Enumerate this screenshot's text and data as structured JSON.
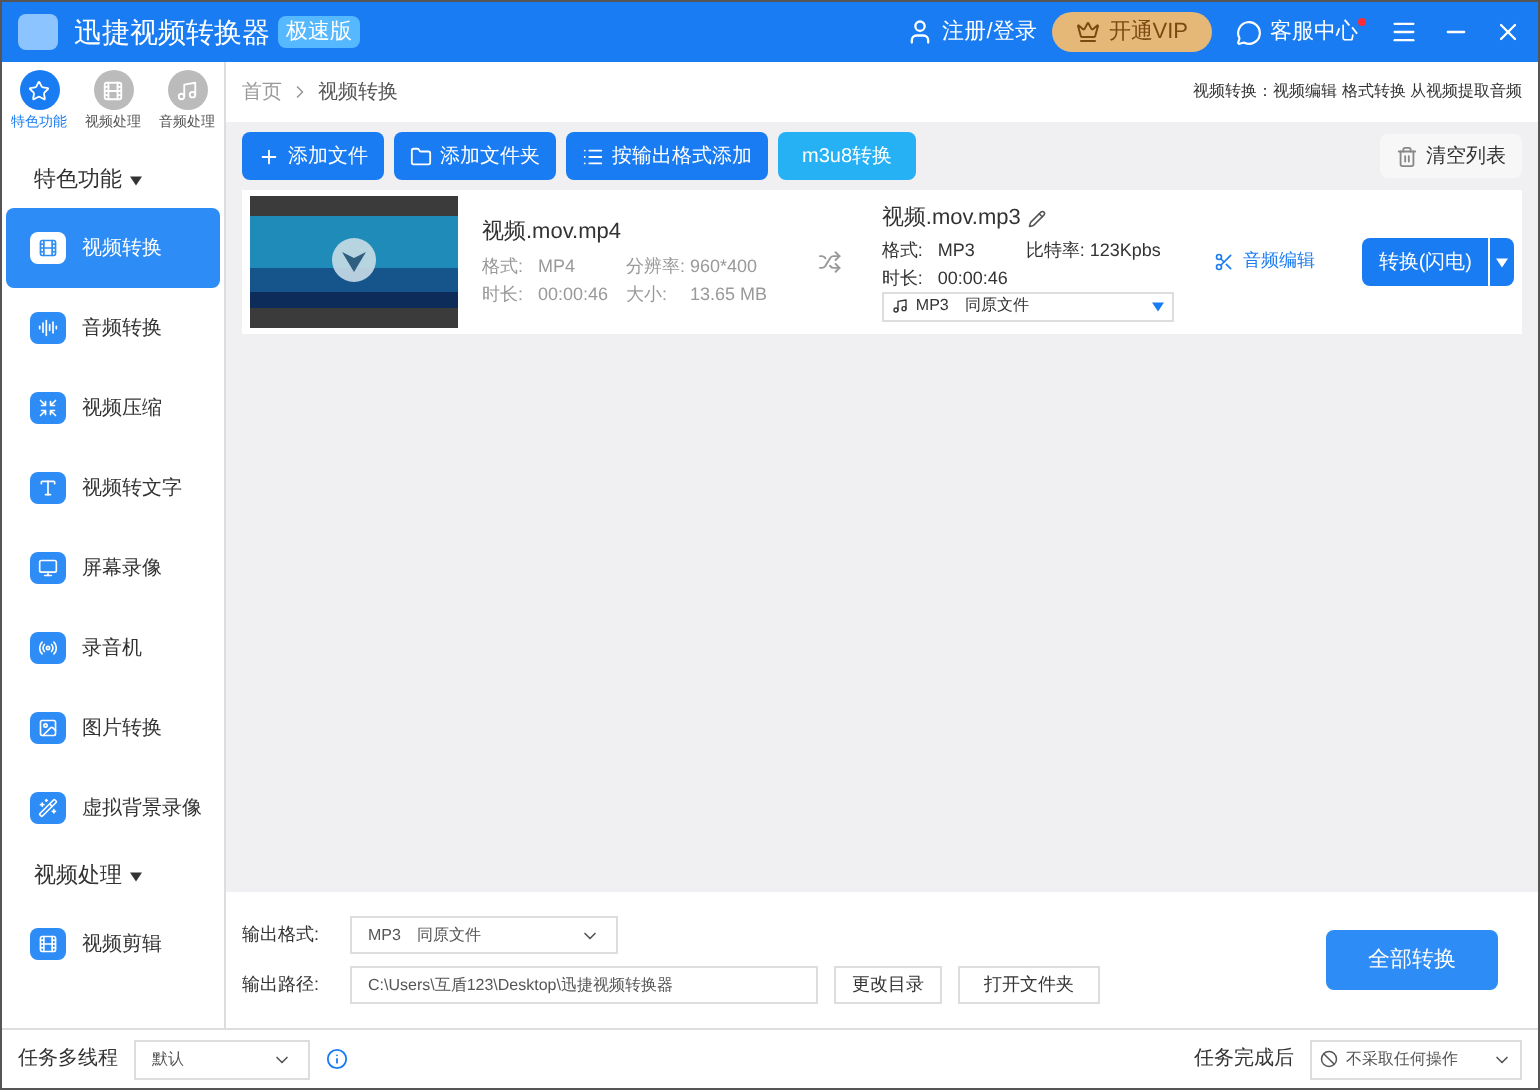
{
  "window": {
    "title": "迅捷视频转换器",
    "badge": "极速版",
    "login": "注册/登录",
    "vip": "开通VIP",
    "service": "客服中心",
    "service_dot": true
  },
  "top_tabs": [
    {
      "label": "特色功能",
      "kind": "star",
      "selected": true
    },
    {
      "label": "视频处理",
      "kind": "film",
      "selected": false
    },
    {
      "label": "音频处理",
      "kind": "music",
      "selected": false
    }
  ],
  "sections": [
    {
      "title": "特色功能",
      "expanded": true,
      "items": [
        {
          "label": "视频转换",
          "kind": "film",
          "selected": true
        },
        {
          "label": "音频转换",
          "kind": "audio",
          "selected": false
        },
        {
          "label": "视频压缩",
          "kind": "compress",
          "selected": false
        },
        {
          "label": "视频转文字",
          "kind": "text",
          "selected": false
        },
        {
          "label": "屏幕录像",
          "kind": "screen",
          "selected": false
        },
        {
          "label": "录音机",
          "kind": "radio",
          "selected": false
        },
        {
          "label": "图片转换",
          "selected": false
        },
        {
          "label": "虚拟背景录像",
          "kind": "wand",
          "selected": false
        }
      ]
    },
    {
      "title": "视频处理",
      "expanded": true,
      "items": [
        {
          "label": "视频剪辑",
          "kind": "film",
          "selected": false
        }
      ]
    }
  ],
  "breadcrumb": [
    "首页",
    "视频转换"
  ],
  "header_links": "视频转换：视频编辑 格式转换 从视频提取音频",
  "toolbar": [
    {
      "label": "添加文件",
      "kind": "plus"
    },
    {
      "label": "添加文件夹",
      "kind": "folder"
    },
    {
      "label": "按输出格式添加",
      "kind": "list"
    },
    {
      "label": "m3u8转换",
      "kind": "plain"
    }
  ],
  "clear_button": "清空列表",
  "files": [
    {
      "kind": "picture",
      "source": {
        "name": "视频.mov.mp4",
        "format_label": "格式:",
        "format": "MP4",
        "resolution_label": "分辨率:",
        "resolution": "960*400",
        "duration_label": "时长:",
        "duration": "00:00:46",
        "size_label": "大小:",
        "size": "13.65 MB"
      },
      "output": {
        "name": "视频.mov.mp3",
        "format_label": "格式:",
        "format": "MP3",
        "bitrate_label": "比特率:",
        "bitrate": "123Kpbs",
        "duration_label": "时长:",
        "duration": "00:00:46",
        "select_format": "MP3",
        "select_quality": "同原文件"
      },
      "edit_link": "音频编辑",
      "convert_button": "转换(闪电)"
    }
  ],
  "output_format": {
    "label": "输出格式:",
    "format": "MP3",
    "quality": "同原文件"
  },
  "output_path": {
    "label": "输出路径:",
    "value": "C:\\Users\\互盾123\\Desktop\\迅捷视频转换器",
    "change": "更改目录",
    "open": "打开文件夹"
  },
  "convert_all": "全部转换",
  "status_bar": {
    "threads_label": "任务多线程",
    "threads_value": "默认",
    "after_label": "任务完成后",
    "after_value": "不采取任何操作"
  }
}
